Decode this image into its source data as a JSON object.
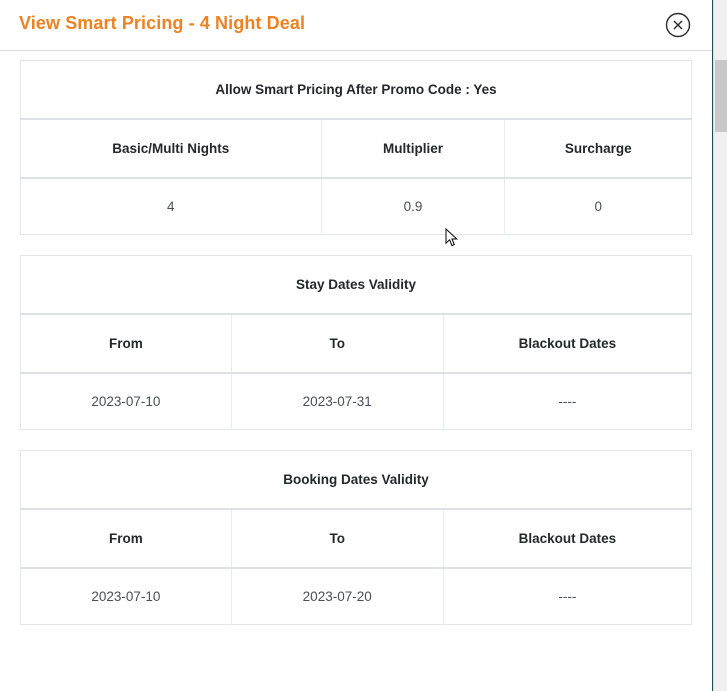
{
  "modal": {
    "title": "View Smart Pricing - 4 Night Deal",
    "close_icon": "close-circle-icon",
    "accent_color": "#ed8222"
  },
  "tables": [
    {
      "caption": "Allow Smart Pricing After Promo Code : Yes",
      "headers": [
        "Basic/Multi Nights",
        "Multiplier",
        "Surcharge"
      ],
      "rows": [
        [
          "4",
          "0.9",
          "0"
        ]
      ]
    },
    {
      "caption": "Stay Dates Validity",
      "headers": [
        "From",
        "To",
        "Blackout Dates"
      ],
      "rows": [
        [
          "2023-07-10",
          "2023-07-31",
          "----"
        ]
      ]
    },
    {
      "caption": "Booking Dates Validity",
      "headers": [
        "From",
        "To",
        "Blackout Dates"
      ],
      "rows": [
        [
          "2023-07-10",
          "2023-07-20",
          "----"
        ]
      ]
    }
  ],
  "scrollbar": {
    "name": "vertical-scrollbar"
  }
}
